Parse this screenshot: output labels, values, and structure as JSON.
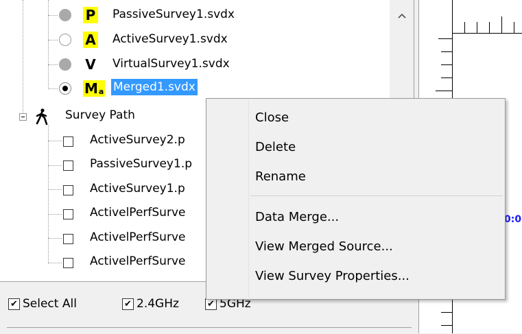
{
  "tree": {
    "surveys": [
      {
        "badge": "P",
        "label": "PassiveSurvey1.svdx",
        "radio": "disabled"
      },
      {
        "badge": "A",
        "label": "ActiveSurvey1.svdx",
        "radio": "empty"
      },
      {
        "badge": "V",
        "label": "VirtualSurvey1.svdx",
        "radio": "disabled"
      },
      {
        "badge": "M",
        "badge_sub": "a",
        "label": "Merged1.svdx",
        "radio": "checked",
        "selected": true
      }
    ],
    "survey_path": {
      "label": "Survey Path",
      "items": [
        "ActiveSurvey2.p",
        "PassiveSurvey1.p",
        "ActiveSurvey1.p",
        "ActivelPerfSurve",
        "ActivelPerfSurve",
        "ActivelPerfSurve"
      ]
    }
  },
  "filters": {
    "select_all": "Select All",
    "band_24": "2.4GHz",
    "band_5": "5GHz"
  },
  "context_menu": {
    "items": [
      "Close",
      "Delete",
      "Rename",
      "Data Merge...",
      "View Merged Source...",
      "View Survey Properties..."
    ]
  },
  "canvas": {
    "coord_text": "0:0"
  },
  "colors": {
    "selection": "#3399ff",
    "badge_yellow": "#ffff00",
    "coord_blue": "#1a1aff"
  },
  "icons": {
    "scroll_up": "chevron-up-icon",
    "survey_path": "walking-person-icon",
    "expander": "minus-box-icon"
  }
}
